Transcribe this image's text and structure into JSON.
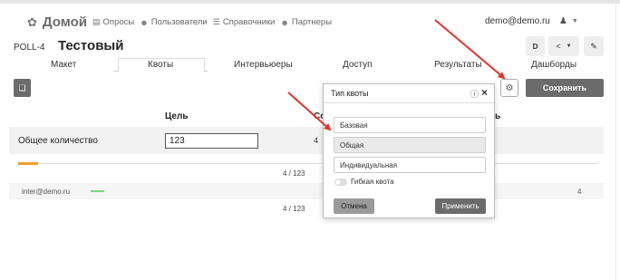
{
  "nav": {
    "home": "Домой",
    "links": [
      "Опросы",
      "Пользователи",
      "Справочники",
      "Партнеры"
    ],
    "user_email": "demo@demo.ru"
  },
  "poll": {
    "id": "POLL-4",
    "name": "Тестовый"
  },
  "toolbar": {
    "d_label": "D",
    "save_label": "Сохранить"
  },
  "tabs": [
    "Макет",
    "Квоты",
    "Интервьюеры",
    "Доступ",
    "Результаты",
    "Дашборды"
  ],
  "active_tab": "Квоты",
  "table": {
    "header_goal": "Цель",
    "header_col2_partial": "Со",
    "header_col3_partial": "ь",
    "row_label": "Общее количество",
    "goal_value": "123",
    "row_col2_partial": "4",
    "progress_fraction": 0.032,
    "count_label": "4 / 123",
    "user_email": "inter@demo.ru",
    "user_right_value": "4",
    "count_label_2": "4 / 123"
  },
  "popup": {
    "title": "Тип квоты",
    "options": [
      "Базовая",
      "Общая",
      "Индивидуальная"
    ],
    "selected_option": "Общая",
    "toggle_label": "Гибкая квота",
    "cancel_label": "Отмена",
    "apply_label": "Применить"
  },
  "colors": {
    "progress": "#f0a030",
    "user_bar": "#7ed67e",
    "arrow": "#e0352b",
    "dark_button": "#6b6b6b"
  }
}
